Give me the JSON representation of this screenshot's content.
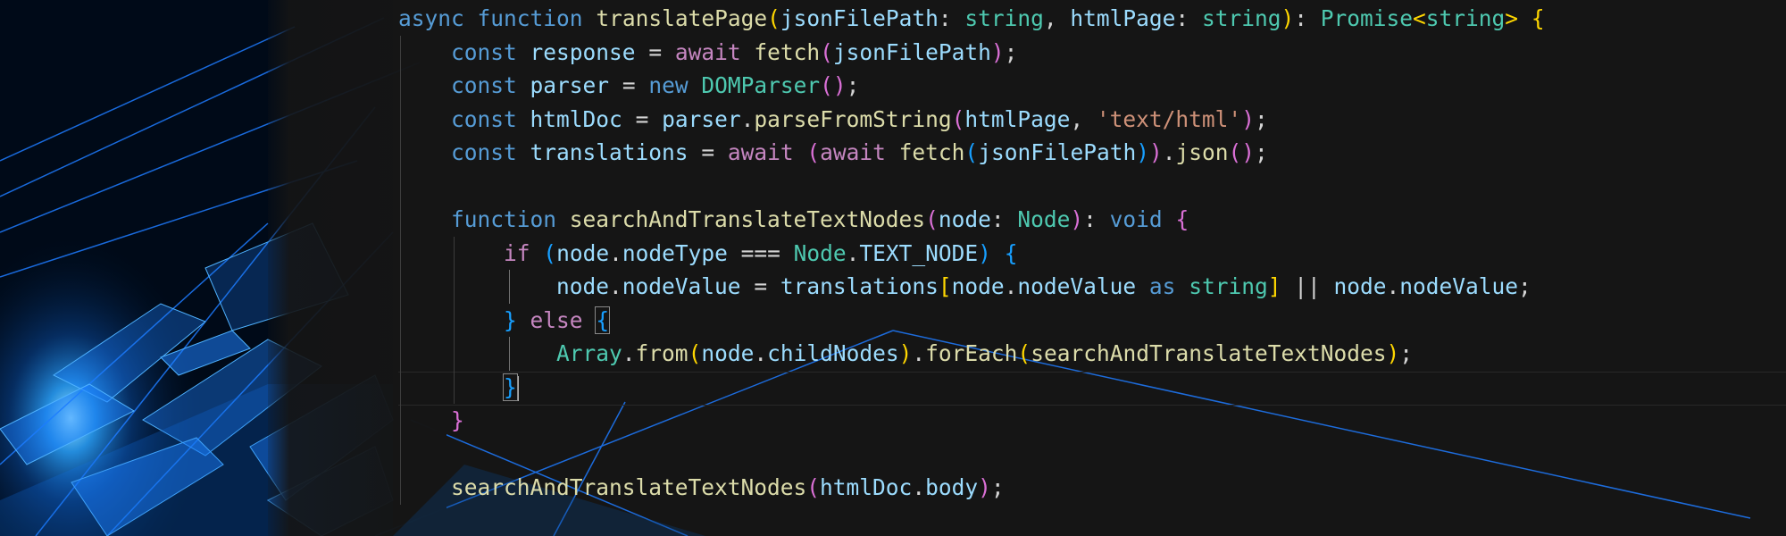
{
  "editor": {
    "language": "typescript",
    "indent_guides": true,
    "lines": [
      {
        "tokens": [
          {
            "t": "async",
            "c": "kw"
          },
          {
            "t": " "
          },
          {
            "t": "function",
            "c": "kw"
          },
          {
            "t": " "
          },
          {
            "t": "translatePage",
            "c": "fn"
          },
          {
            "t": "(",
            "c": "b1"
          },
          {
            "t": "jsonFilePath",
            "c": "var"
          },
          {
            "t": ": "
          },
          {
            "t": "string",
            "c": "type"
          },
          {
            "t": ", "
          },
          {
            "t": "htmlPage",
            "c": "var"
          },
          {
            "t": ": "
          },
          {
            "t": "string",
            "c": "type"
          },
          {
            "t": ")",
            "c": "b1"
          },
          {
            "t": ": "
          },
          {
            "t": "Promise",
            "c": "type"
          },
          {
            "t": "<",
            "c": "b1"
          },
          {
            "t": "string",
            "c": "type"
          },
          {
            "t": ">",
            "c": "b1"
          },
          {
            "t": " "
          },
          {
            "t": "{",
            "c": "b1"
          }
        ]
      },
      {
        "tokens": [
          {
            "t": "    "
          },
          {
            "t": "const",
            "c": "kw"
          },
          {
            "t": " "
          },
          {
            "t": "response",
            "c": "var"
          },
          {
            "t": " = "
          },
          {
            "t": "await",
            "c": "ctl"
          },
          {
            "t": " "
          },
          {
            "t": "fetch",
            "c": "fn"
          },
          {
            "t": "(",
            "c": "b2"
          },
          {
            "t": "jsonFilePath",
            "c": "var"
          },
          {
            "t": ")",
            "c": "b2"
          },
          {
            "t": ";"
          }
        ]
      },
      {
        "tokens": [
          {
            "t": "    "
          },
          {
            "t": "const",
            "c": "kw"
          },
          {
            "t": " "
          },
          {
            "t": "parser",
            "c": "var"
          },
          {
            "t": " = "
          },
          {
            "t": "new",
            "c": "kw"
          },
          {
            "t": " "
          },
          {
            "t": "DOMParser",
            "c": "type"
          },
          {
            "t": "()",
            "c": "b2"
          },
          {
            "t": ";"
          }
        ]
      },
      {
        "tokens": [
          {
            "t": "    "
          },
          {
            "t": "const",
            "c": "kw"
          },
          {
            "t": " "
          },
          {
            "t": "htmlDoc",
            "c": "var"
          },
          {
            "t": " = "
          },
          {
            "t": "parser",
            "c": "var"
          },
          {
            "t": "."
          },
          {
            "t": "parseFromString",
            "c": "fn"
          },
          {
            "t": "(",
            "c": "b2"
          },
          {
            "t": "htmlPage",
            "c": "var"
          },
          {
            "t": ", "
          },
          {
            "t": "'text/html'",
            "c": "str"
          },
          {
            "t": ")",
            "c": "b2"
          },
          {
            "t": ";"
          }
        ]
      },
      {
        "tokens": [
          {
            "t": "    "
          },
          {
            "t": "const",
            "c": "kw"
          },
          {
            "t": " "
          },
          {
            "t": "translations",
            "c": "var"
          },
          {
            "t": " = "
          },
          {
            "t": "await",
            "c": "ctl"
          },
          {
            "t": " "
          },
          {
            "t": "(",
            "c": "b2"
          },
          {
            "t": "await",
            "c": "ctl"
          },
          {
            "t": " "
          },
          {
            "t": "fetch",
            "c": "fn"
          },
          {
            "t": "(",
            "c": "b3"
          },
          {
            "t": "jsonFilePath",
            "c": "var"
          },
          {
            "t": ")",
            "c": "b3"
          },
          {
            "t": ")",
            "c": "b2"
          },
          {
            "t": "."
          },
          {
            "t": "json",
            "c": "fn"
          },
          {
            "t": "()",
            "c": "b2"
          },
          {
            "t": ";"
          }
        ]
      },
      {
        "tokens": []
      },
      {
        "tokens": [
          {
            "t": "    "
          },
          {
            "t": "function",
            "c": "kw"
          },
          {
            "t": " "
          },
          {
            "t": "searchAndTranslateTextNodes",
            "c": "fn"
          },
          {
            "t": "(",
            "c": "b2"
          },
          {
            "t": "node",
            "c": "var"
          },
          {
            "t": ": "
          },
          {
            "t": "Node",
            "c": "type"
          },
          {
            "t": ")",
            "c": "b2"
          },
          {
            "t": ": "
          },
          {
            "t": "void",
            "c": "kw"
          },
          {
            "t": " "
          },
          {
            "t": "{",
            "c": "b2"
          }
        ]
      },
      {
        "tokens": [
          {
            "t": "        "
          },
          {
            "t": "if",
            "c": "ctl"
          },
          {
            "t": " "
          },
          {
            "t": "(",
            "c": "b3"
          },
          {
            "t": "node",
            "c": "var"
          },
          {
            "t": "."
          },
          {
            "t": "nodeType",
            "c": "var"
          },
          {
            "t": " === "
          },
          {
            "t": "Node",
            "c": "type"
          },
          {
            "t": "."
          },
          {
            "t": "TEXT_NODE",
            "c": "var"
          },
          {
            "t": ")",
            "c": "b3"
          },
          {
            "t": " "
          },
          {
            "t": "{",
            "c": "b3"
          }
        ]
      },
      {
        "tokens": [
          {
            "t": "            "
          },
          {
            "t": "node",
            "c": "var"
          },
          {
            "t": "."
          },
          {
            "t": "nodeValue",
            "c": "var"
          },
          {
            "t": " = "
          },
          {
            "t": "translations",
            "c": "var"
          },
          {
            "t": "[",
            "c": "b1"
          },
          {
            "t": "node",
            "c": "var"
          },
          {
            "t": "."
          },
          {
            "t": "nodeValue",
            "c": "var"
          },
          {
            "t": " "
          },
          {
            "t": "as",
            "c": "kw"
          },
          {
            "t": " "
          },
          {
            "t": "string",
            "c": "type"
          },
          {
            "t": "]",
            "c": "b1"
          },
          {
            "t": " || "
          },
          {
            "t": "node",
            "c": "var"
          },
          {
            "t": "."
          },
          {
            "t": "nodeValue",
            "c": "var"
          },
          {
            "t": ";"
          }
        ]
      },
      {
        "tokens": [
          {
            "t": "        "
          },
          {
            "t": "}",
            "c": "b3"
          },
          {
            "t": " "
          },
          {
            "t": "else",
            "c": "ctl"
          },
          {
            "t": " "
          },
          {
            "t": "{",
            "c": "b3",
            "box": true
          }
        ]
      },
      {
        "tokens": [
          {
            "t": "            "
          },
          {
            "t": "Array",
            "c": "type"
          },
          {
            "t": "."
          },
          {
            "t": "from",
            "c": "fn"
          },
          {
            "t": "(",
            "c": "b1"
          },
          {
            "t": "node",
            "c": "var"
          },
          {
            "t": "."
          },
          {
            "t": "childNodes",
            "c": "var"
          },
          {
            "t": ")",
            "c": "b1"
          },
          {
            "t": "."
          },
          {
            "t": "forEach",
            "c": "fn"
          },
          {
            "t": "(",
            "c": "b1"
          },
          {
            "t": "searchAndTranslateTextNodes",
            "c": "fn"
          },
          {
            "t": ")",
            "c": "b1"
          },
          {
            "t": ";"
          }
        ]
      },
      {
        "tokens": [
          {
            "t": "        "
          },
          {
            "t": "}",
            "c": "b3",
            "box": true,
            "cursor": true
          }
        ]
      },
      {
        "tokens": [
          {
            "t": "    "
          },
          {
            "t": "}",
            "c": "b2"
          }
        ]
      },
      {
        "tokens": []
      },
      {
        "tokens": [
          {
            "t": "    "
          },
          {
            "t": "searchAndTranslateTextNodes",
            "c": "fn"
          },
          {
            "t": "(",
            "c": "b2"
          },
          {
            "t": "htmlDoc",
            "c": "var"
          },
          {
            "t": "."
          },
          {
            "t": "body",
            "c": "var"
          },
          {
            "t": ")",
            "c": "b2"
          },
          {
            "t": ";"
          }
        ]
      }
    ]
  }
}
